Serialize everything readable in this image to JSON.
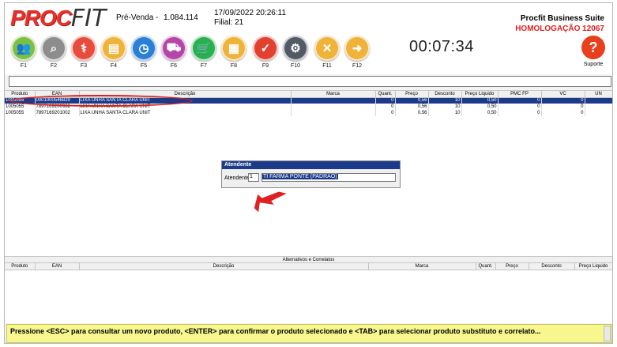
{
  "header": {
    "logo_pro": "PROC",
    "logo_fit": "FIT",
    "mode": "Pré-Venda -",
    "code": "1.084.114",
    "datetime": "17/09/2022 20:26:11",
    "filial": "Filial: 21",
    "suite": "Procfit Business Suite",
    "environment": "HOMOLOGAÇÃO 12067"
  },
  "toolbar": {
    "buttons": [
      {
        "label": "F1",
        "icon": "users-icon",
        "color": "#7dbf3f"
      },
      {
        "label": "F2",
        "icon": "search-icon",
        "color": "#8d8d8d"
      },
      {
        "label": "F3",
        "icon": "caduceus-icon",
        "color": "#e84c3d"
      },
      {
        "label": "F4",
        "icon": "id-card-icon",
        "color": "#f0b33a"
      },
      {
        "label": "F5",
        "icon": "clock-icon",
        "color": "#2a7fd8"
      },
      {
        "label": "F6",
        "icon": "truck-icon",
        "color": "#b546a7"
      },
      {
        "label": "F7",
        "icon": "cart-icon",
        "color": "#27b24f"
      },
      {
        "label": "F8",
        "icon": "document-icon",
        "color": "#f0b33a"
      },
      {
        "label": "F9",
        "icon": "check-icon",
        "color": "#e2412f"
      },
      {
        "label": "F10",
        "icon": "gears-icon",
        "color": "#525a66"
      },
      {
        "label": "F11",
        "icon": "cancel-icon",
        "color": "#f0b33a"
      },
      {
        "label": "F12",
        "icon": "arrow-right-icon",
        "color": "#f0b33a"
      }
    ],
    "timer": "00:07:34",
    "help_label": "Suporte",
    "help_glyph": "?"
  },
  "grid": {
    "columns": [
      "Produto",
      "EAN",
      "Descrição",
      "Marca",
      "Quant.",
      "Preço",
      "Desconto",
      "Preço Liquido",
      "PMC FP",
      "VC",
      "UN"
    ],
    "rows": [
      {
        "produto": "1005055",
        "ean": "0001000546829",
        "descricao": "LIXA UNHA SANTA CLARA UNIT",
        "marca": "",
        "quant": "0",
        "preco": "0,56",
        "desconto": "10",
        "liquido": "0,50",
        "pmc": "0",
        "vc": "0",
        "un": ""
      },
      {
        "produto": "1005055",
        "ean": "7897169200982",
        "descricao": "LIXA UNHA SANTA CLARA UNIT",
        "marca": "",
        "quant": "0",
        "preco": "0,56",
        "desconto": "10",
        "liquido": "0,50",
        "pmc": "0",
        "vc": "0",
        "un": ""
      },
      {
        "produto": "1005055",
        "ean": "7897169201002",
        "descricao": "LIXA UNHA SANTA CLARA UNIT",
        "marca": "",
        "quant": "0",
        "preco": "0,56",
        "desconto": "10",
        "liquido": "0,50",
        "pmc": "0",
        "vc": "0",
        "un": ""
      }
    ]
  },
  "dialog": {
    "title": "Atendente",
    "label": "Atendente",
    "number": "1",
    "name": "TI FARMA PONTE (PADRAO)"
  },
  "alt": {
    "title": "Alternativos e Correlatos",
    "columns": [
      "Produto",
      "EAN",
      "Descrição",
      "Marca",
      "Quant.",
      "Preço",
      "Desconto",
      "Preço Liquido"
    ]
  },
  "status": "Pressione <ESC> para consultar um novo produto, <ENTER> para confirmar o produto selecionado e <TAB> para selecionar produto substituto e correlato..."
}
